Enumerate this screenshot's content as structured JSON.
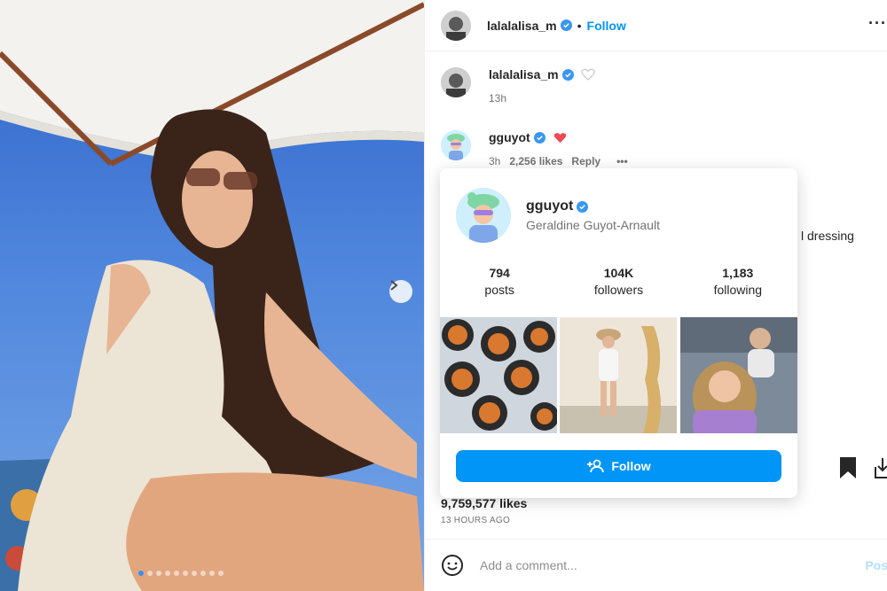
{
  "post": {
    "carousel": {
      "total_slides": 10,
      "active_index": 0
    }
  },
  "header": {
    "username": "lalalalisa_m",
    "separator": "•",
    "follow_label": "Follow",
    "more_label": "···"
  },
  "comments": [
    {
      "username": "lalalalisa_m",
      "time": "13h"
    },
    {
      "username": "gguyot",
      "time": "3h",
      "likes": "2,256 likes",
      "reply_label": "Reply",
      "more_label": "•••"
    }
  ],
  "partial_text": "l dressing",
  "hover_card": {
    "username": "gguyot",
    "full_name": "Geraldine Guyot-Arnault",
    "stats": [
      {
        "value": "794",
        "label": "posts"
      },
      {
        "value": "104K",
        "label": "followers"
      },
      {
        "value": "1,183",
        "label": "following"
      }
    ],
    "follow_label": "Follow"
  },
  "actions": {
    "likes": "9,759,577 likes",
    "timestamp": "13 HOURS AGO"
  },
  "comment_box": {
    "placeholder": "Add a comment...",
    "post_label": "Pos"
  },
  "colors": {
    "accent": "#0095f6",
    "verified": "#3897f0",
    "heart_red": "#ed4956"
  }
}
